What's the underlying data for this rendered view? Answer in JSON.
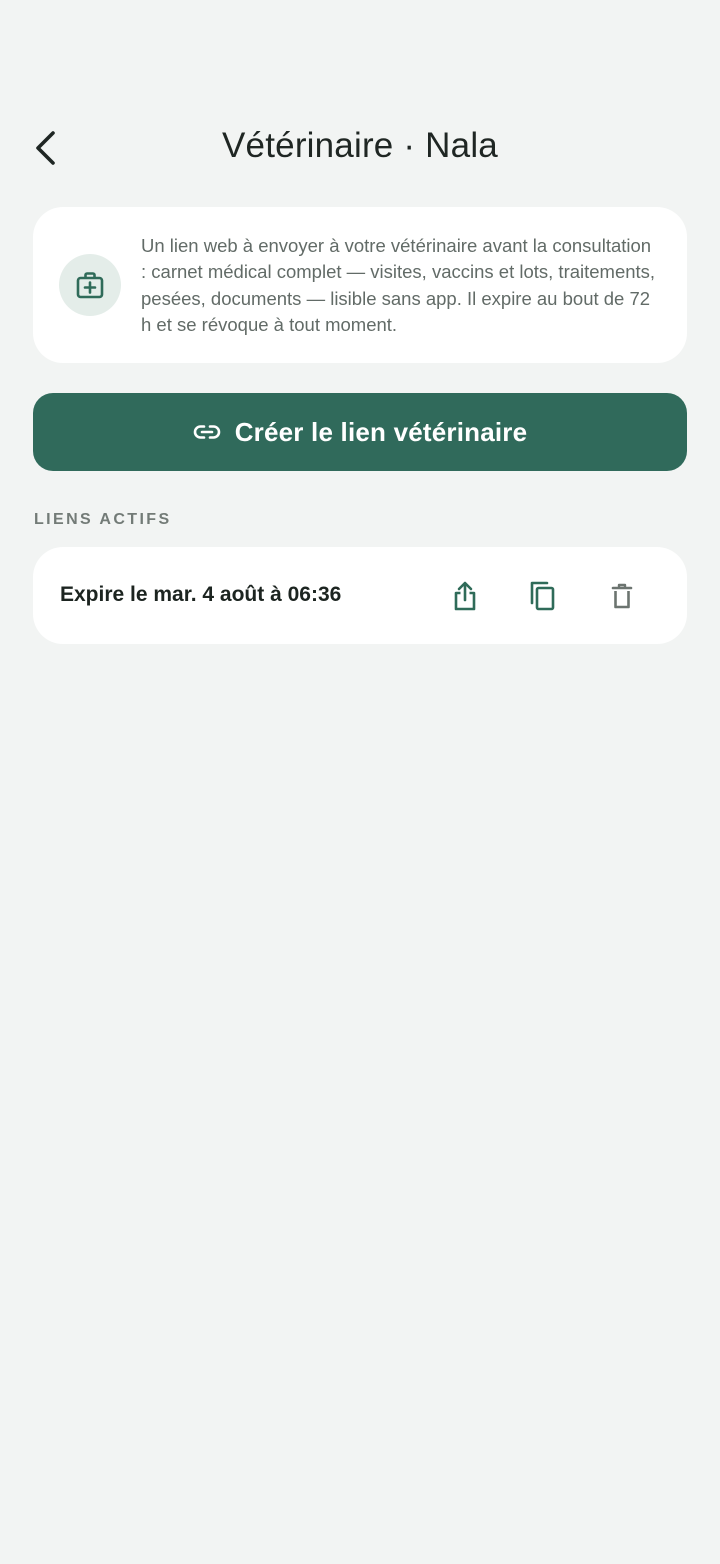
{
  "header": {
    "title": "Vétérinaire · Nala"
  },
  "info_card": {
    "icon": "medical-kit-icon",
    "text": "Un lien web à envoyer à votre vétérinaire avant la consultation : carnet médical complet — visites, vaccins et lots, traitements, pesées, documents — lisible sans app. Il expire au bout de 72 h et se révoque à tout moment."
  },
  "create_button": {
    "label": "Créer le lien vétérinaire",
    "icon": "link-icon"
  },
  "active_links": {
    "section_label": "LIENS ACTIFS",
    "items": [
      {
        "expiry": "Expire le mar. 4 août à 06:36",
        "actions": [
          "share-icon",
          "copy-icon",
          "trash-icon"
        ]
      }
    ]
  },
  "colors": {
    "background": "#f2f4f3",
    "accent": "#306a5b",
    "icon_green": "#2f6b59",
    "icon_grey": "#6c7470",
    "card": "#ffffff"
  }
}
